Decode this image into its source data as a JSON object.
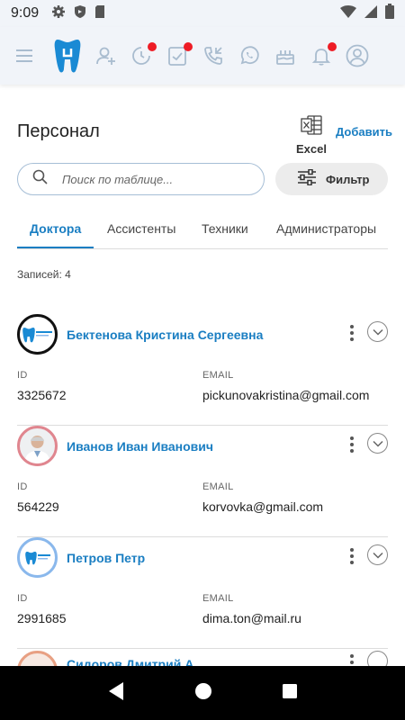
{
  "status_bar": {
    "time": "9:09"
  },
  "header": {
    "title": "Персонал",
    "excel_label": "Excel",
    "add_label": "Добавить"
  },
  "search": {
    "placeholder": "Поиск по таблице..."
  },
  "filter": {
    "label": "Фильтр"
  },
  "tabs": [
    {
      "label": "Доктора",
      "active": true
    },
    {
      "label": "Ассистенты",
      "active": false
    },
    {
      "label": "Техники",
      "active": false
    },
    {
      "label": "Администраторы",
      "active": false
    }
  ],
  "records": {
    "label": "Записей: 4"
  },
  "field_labels": {
    "id": "ID",
    "email": "EMAIL"
  },
  "staff": [
    {
      "name": "Бектенова Кристина Сергеевна",
      "id": "3325672",
      "email": "pickunovakristina@gmail.com",
      "ring_color": "#111111"
    },
    {
      "name": "Иванов Иван Иванович",
      "id": "564229",
      "email": "korvovka@gmail.com",
      "ring_color": "#e0868f"
    },
    {
      "name": "Петров Петр",
      "id": "2991685",
      "email": "dima.ton@mail.ru",
      "ring_color": "#8ab8ec"
    },
    {
      "name": "Сидоров Дмитрий А.",
      "ring_color": "#e8a083"
    }
  ],
  "colors": {
    "accent": "#1a7ec2",
    "notification": "#ee1c25",
    "nav_bg": "#f1f4f9"
  }
}
